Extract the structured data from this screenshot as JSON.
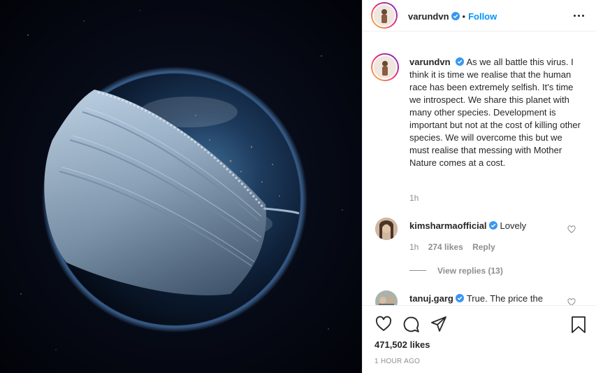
{
  "post": {
    "author": "varundvn",
    "follow_label": "Follow",
    "dot": "•"
  },
  "caption": {
    "username": "varundvn",
    "text": "As we all battle this virus. I think it is time we realise that the human race has been extremely selfish. It's time we introspect. We share this planet with many other species. Development is important but not at the cost of killing other species. We will overcome this but we must realise that messing with Mother Nature comes at a cost.",
    "time": "1h"
  },
  "comments": [
    {
      "username": "kimsharmaofficial",
      "text": "Lovely",
      "time": "1h",
      "likes": "274 likes",
      "reply_label": "Reply",
      "view_replies": "View replies (13)"
    },
    {
      "username": "tanuj.garg",
      "text": "True. The price the"
    }
  ],
  "footer": {
    "likes": "471,502 likes",
    "timestamp": "1 HOUR AGO"
  },
  "icons": {
    "like": "heart-icon",
    "comment": "comment-icon",
    "share": "paper-plane-icon",
    "save": "bookmark-icon",
    "more": "more-options-icon",
    "verified": "verified-badge-icon"
  },
  "colors": {
    "accent": "#0095f6",
    "verified": "#3897f0",
    "muted": "#8e8e8e",
    "text": "#262626"
  }
}
